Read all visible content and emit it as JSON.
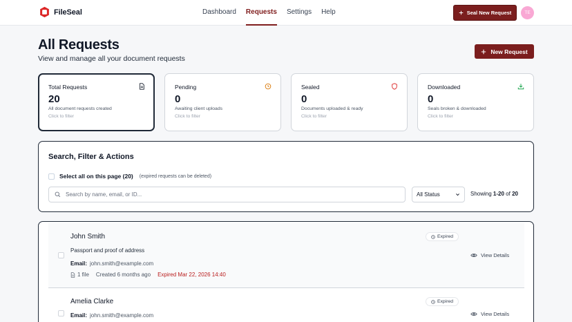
{
  "app": {
    "name": "FileSeal"
  },
  "nav": {
    "items": [
      {
        "label": "Dashboard"
      },
      {
        "label": "Requests"
      },
      {
        "label": "Settings"
      },
      {
        "label": "Help"
      }
    ],
    "active": "Requests"
  },
  "header": {
    "seal_button_label": "Seal New Request",
    "avatar_initials": "TE"
  },
  "page": {
    "title": "All Requests",
    "subtitle": "View and manage all your document requests",
    "new_button_label": "New Request"
  },
  "stats": [
    {
      "label": "Total Requests",
      "value": "20",
      "desc": "All document requests created",
      "hint": "Click to filter",
      "icon": "document-icon",
      "color": "#111827"
    },
    {
      "label": "Pending",
      "value": "0",
      "desc": "Awaiting client uploads",
      "hint": "Click to filter",
      "icon": "clock-icon",
      "color": "#d97706"
    },
    {
      "label": "Sealed",
      "value": "0",
      "desc": "Documents uploaded & ready",
      "hint": "Click to filter",
      "icon": "shield-icon",
      "color": "#dc2626"
    },
    {
      "label": "Downloaded",
      "value": "0",
      "desc": "Seals broken & downloaded",
      "hint": "Click to filter",
      "icon": "download-icon",
      "color": "#16a34a"
    }
  ],
  "filters": {
    "title": "Search, Filter & Actions",
    "select_all_label": "Select all on this page (20)",
    "select_all_note": "(expired requests can be deleted)",
    "search_placeholder": "Search by name, email, or ID...",
    "status_value": "All Status",
    "showing_prefix": "Showing",
    "showing_range": "1-20",
    "showing_of": "of",
    "showing_total": "20"
  },
  "requests": [
    {
      "name": "John Smith",
      "description": "Passport and proof of address",
      "email_label": "Email:",
      "email": "john.smith@example.com",
      "files": "1 file",
      "created": "Created 6 months ago",
      "expired": "Expired Mar 22, 2026 14:40",
      "badge": "Expired",
      "action": "View Details"
    },
    {
      "name": "Amelia Clarke",
      "email_label": "Email:",
      "email": "john.smith@example.com",
      "badge": "Expired",
      "action": "View Details"
    }
  ]
}
